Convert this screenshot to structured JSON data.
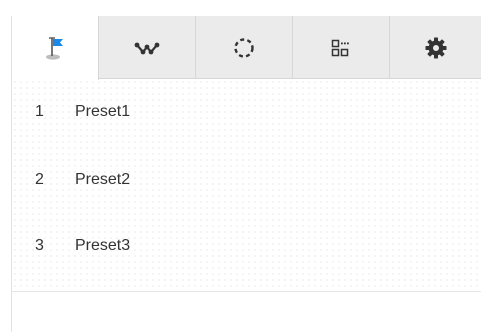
{
  "tabs": [
    {
      "icon": "preset-flag-icon",
      "active": true
    },
    {
      "icon": "tour-path-icon",
      "active": false
    },
    {
      "icon": "scan-circle-icon",
      "active": false
    },
    {
      "icon": "pattern-grid-icon",
      "active": false
    },
    {
      "icon": "settings-gear-icon",
      "active": false
    }
  ],
  "colors": {
    "tab_bar_bg": "#ebebeb",
    "active_tab_bg": "#ffffff",
    "flag_blue": "#1e88e5",
    "icon_dark": "#333333",
    "text": "#333333"
  },
  "presets": [
    {
      "number": "1",
      "name": "Preset1"
    },
    {
      "number": "2",
      "name": "Preset2"
    },
    {
      "number": "3",
      "name": "Preset3"
    }
  ]
}
